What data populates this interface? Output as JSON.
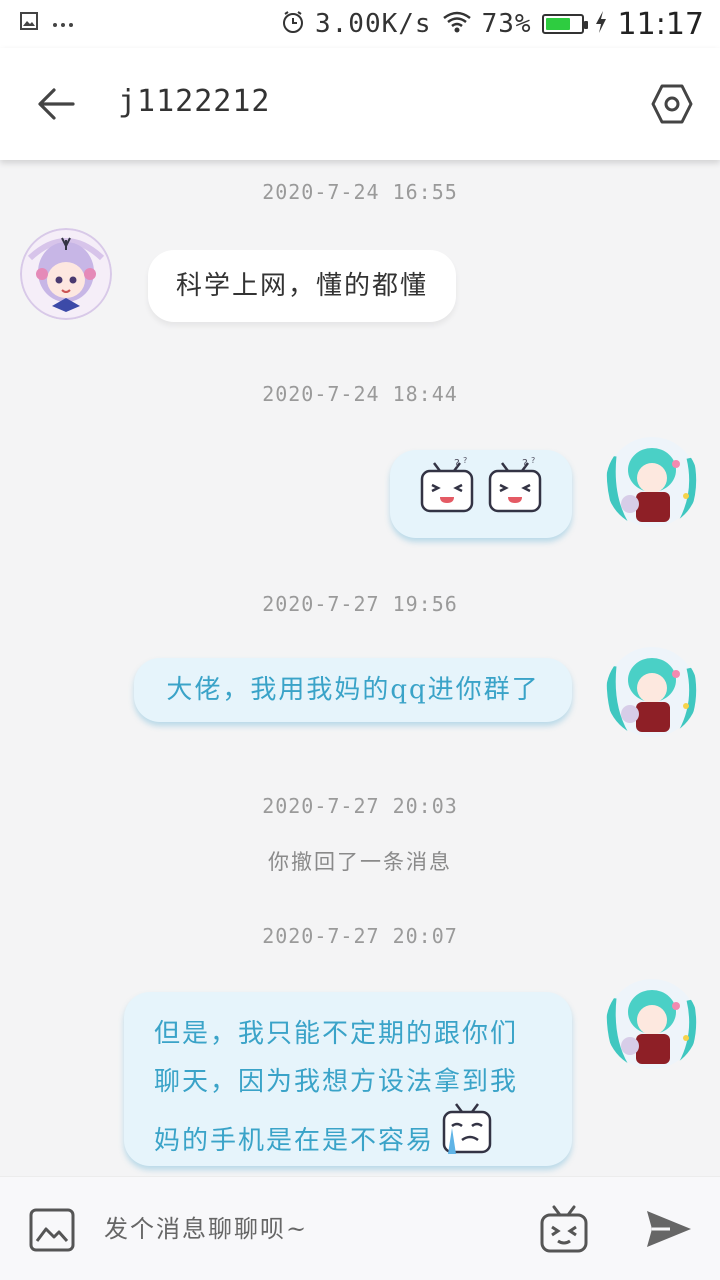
{
  "status_bar": {
    "network_speed": "3.00K/s",
    "battery_percent": "73%",
    "battery_level": 0.73,
    "time": "11:17",
    "icons": [
      "image-icon",
      "more-icon",
      "alarm-icon",
      "wifi-icon",
      "battery-icon",
      "charging-icon"
    ]
  },
  "header": {
    "title": "j1122212",
    "icons": [
      "back-arrow-icon",
      "settings-hexagon-icon"
    ]
  },
  "messages": [
    {
      "timestamp": "2020-7-24 16:55",
      "direction": "in",
      "text": "科学上网，懂的都懂"
    },
    {
      "timestamp": "2020-7-24 18:44",
      "direction": "out",
      "text": "",
      "stickers": [
        "tv-face-sticker",
        "tv-face-sticker"
      ]
    },
    {
      "timestamp": "2020-7-27 19:56",
      "direction": "out",
      "text": "大佬，我用我妈的qq进你群了"
    },
    {
      "timestamp": "2020-7-27 20:03",
      "system": "你撤回了一条消息"
    },
    {
      "timestamp": "2020-7-27 20:07",
      "direction": "out",
      "lines": [
        "但是，我只能不定期的跟你们",
        "聊天，因为我想方设法拿到我",
        "妈的手机是在是不容易"
      ],
      "stickers": [
        "crying-tv-sticker"
      ]
    }
  ],
  "input": {
    "placeholder": "发个消息聊聊呗~"
  },
  "colors": {
    "accent": "#3aa3c8",
    "outgoing_bubble": "#e6f4fb",
    "incoming_bubble": "#ffffff",
    "background": "#f4f4f5",
    "battery": "#2ecc40"
  }
}
